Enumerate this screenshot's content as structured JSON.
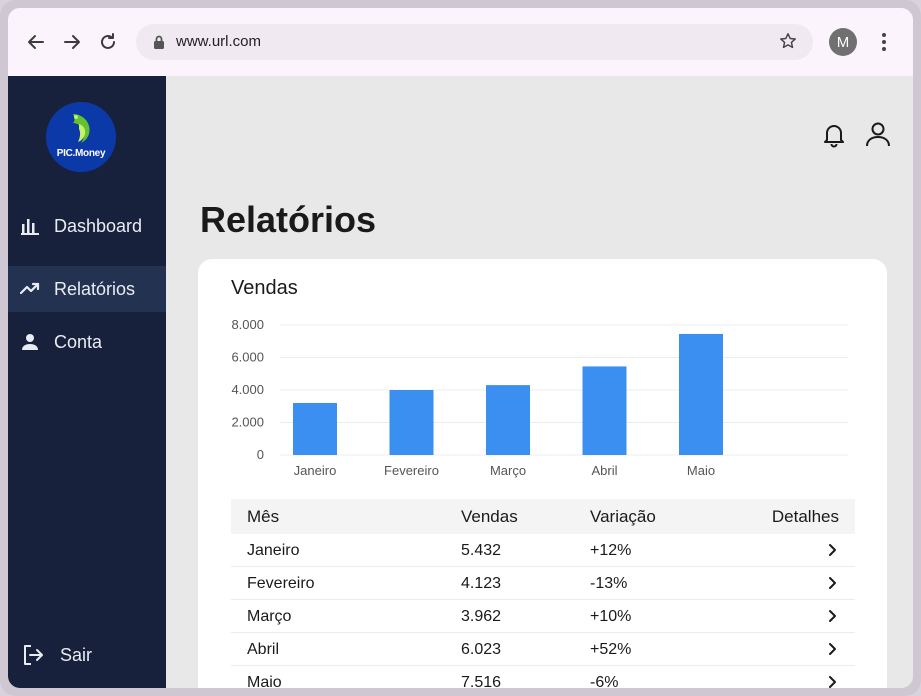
{
  "browser": {
    "url": "www.url.com",
    "profile_initial": "M"
  },
  "sidebar": {
    "logo_text": "PIC.Money",
    "items": [
      {
        "label": "Dashboard",
        "icon": "bar-chart-icon"
      },
      {
        "label": "Relatórios",
        "icon": "trending-up-icon",
        "active": true
      },
      {
        "label": "Conta",
        "icon": "person-icon"
      }
    ],
    "logout_label": "Sair"
  },
  "header": {
    "title": "Relatórios"
  },
  "card": {
    "title": "Vendas"
  },
  "chart_data": {
    "type": "bar",
    "categories": [
      "Janeiro",
      "Fevereiro",
      "Março",
      "Abril",
      "Maio"
    ],
    "values": [
      3200,
      4000,
      4300,
      5450,
      7450
    ],
    "ylim": [
      0,
      8000
    ],
    "yticks": [
      "8.000",
      "6.000",
      "4.000",
      "2.000",
      "0"
    ],
    "ytick_values": [
      8000,
      6000,
      4000,
      2000,
      0
    ],
    "bar_color": "#3a8ff0",
    "grid": true
  },
  "table": {
    "headers": [
      "Mês",
      "Vendas",
      "Variação",
      "Detalhes"
    ],
    "rows": [
      {
        "mes": "Janeiro",
        "vendas": "5.432",
        "variacao": "+12%"
      },
      {
        "mes": "Fevereiro",
        "vendas": "4.123",
        "variacao": "-13%"
      },
      {
        "mes": "Março",
        "vendas": "3.962",
        "variacao": "+10%"
      },
      {
        "mes": "Abril",
        "vendas": "6.023",
        "variacao": "+52%"
      },
      {
        "mes": "Maio",
        "vendas": "7.516",
        "variacao": "-6%"
      }
    ]
  },
  "colors": {
    "sidebar": "#17213b",
    "sidebar_active": "#243252",
    "accent": "#3a8ff0"
  }
}
